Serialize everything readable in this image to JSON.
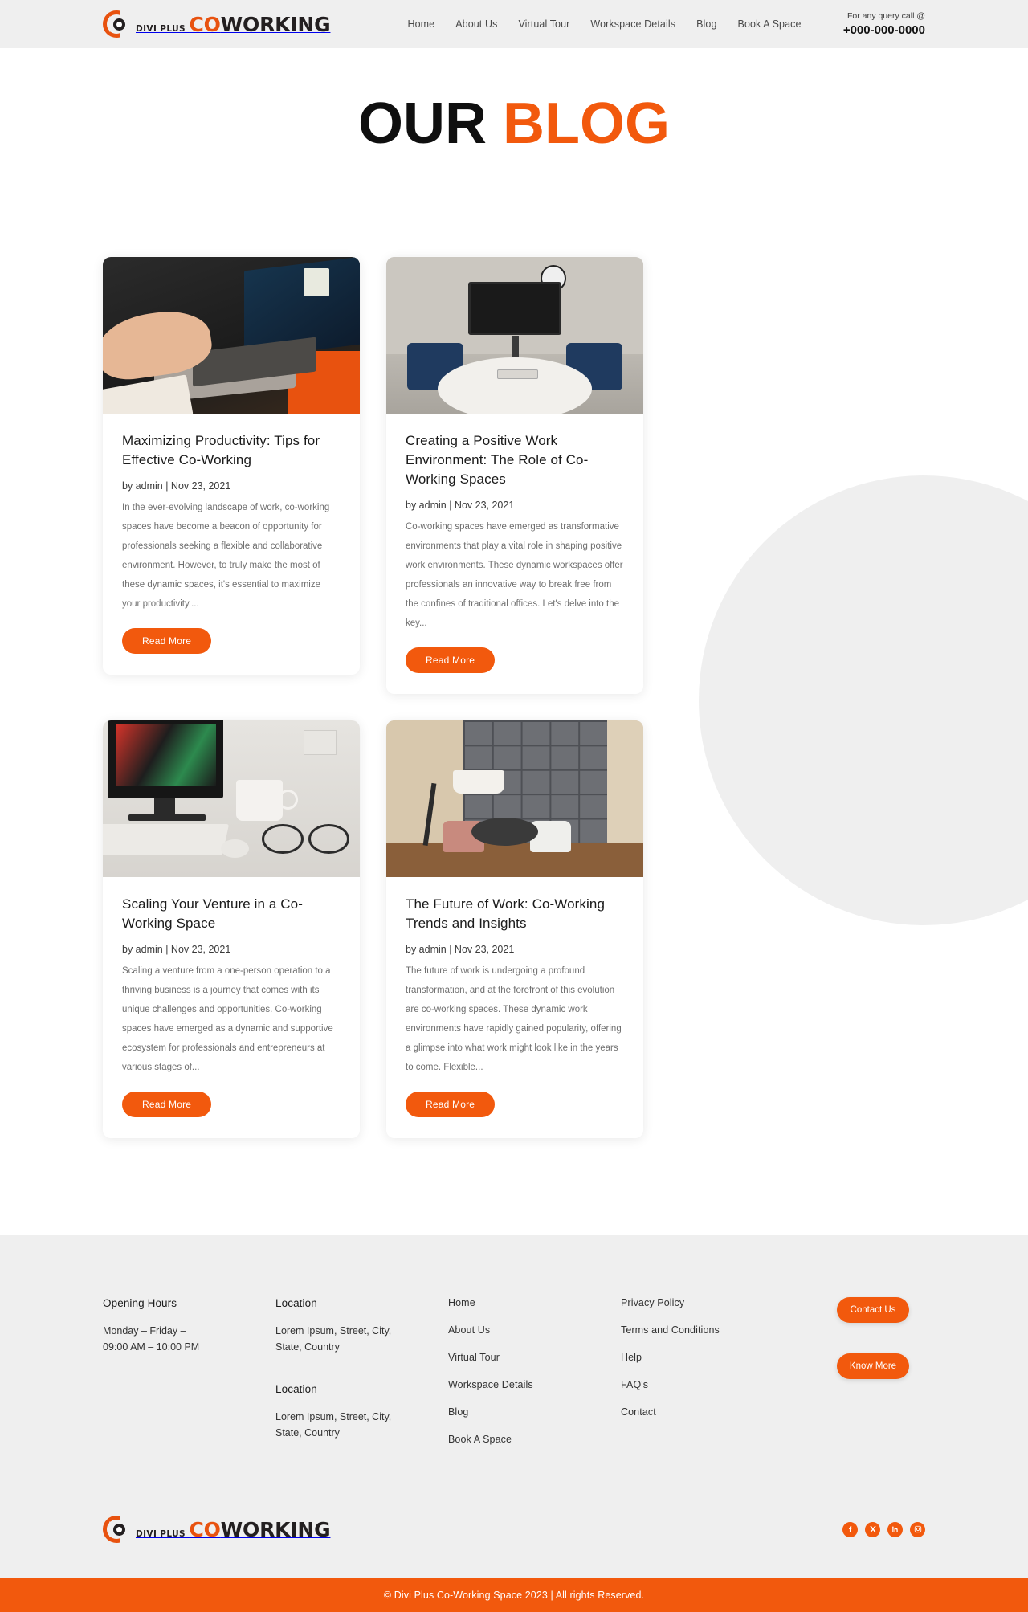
{
  "header": {
    "logo": {
      "kicker": "DIVI PLUS",
      "word_accent": "CO",
      "word_rest": "WORKING"
    },
    "nav": [
      {
        "label": "Home"
      },
      {
        "label": "About Us"
      },
      {
        "label": "Virtual Tour"
      },
      {
        "label": "Workspace Details"
      },
      {
        "label": "Blog"
      },
      {
        "label": "Book A Space"
      }
    ],
    "contact": {
      "query_label": "For any query call @",
      "phone": "+000-000-0000"
    }
  },
  "hero": {
    "title_dark": "OUR",
    "title_accent": "BLOG"
  },
  "blog": {
    "posts": [
      {
        "title": "Maximizing Productivity: Tips for Effective Co-Working",
        "meta": "by admin | Nov 23, 2021",
        "excerpt": "In the ever-evolving landscape of work, co-working spaces have become a beacon of opportunity for professionals seeking a flexible and collaborative environment. However, to truly make the most of these dynamic spaces, it's essential to maximize your productivity....",
        "button": "Read More",
        "image": "person-typing-on-laptop-photo"
      },
      {
        "title": "Creating a Positive Work Environment: The Role of Co-Working Spaces",
        "meta": "by admin | Nov 23, 2021",
        "excerpt": "Co-working spaces have emerged as transformative environments that play a vital role in shaping positive work environments. These dynamic workspaces offer professionals an innovative way to break free from the confines of traditional offices. Let's delve into the key...",
        "button": "Read More",
        "image": "meeting-room-with-monitor-photo"
      },
      {
        "title": "Scaling Your Venture in a Co-Working Space",
        "meta": "by admin | Nov 23, 2021",
        "excerpt": "Scaling a venture from a one-person operation to a thriving business is a journey that comes with its unique challenges and opportunities. Co-working spaces have emerged as a dynamic and supportive ecosystem for professionals and entrepreneurs at various stages of...",
        "button": "Read More",
        "image": "desk-with-monitor-mug-glasses-photo"
      },
      {
        "title": "The Future of Work: Co-Working Trends and Insights",
        "meta": "by admin | Nov 23, 2021",
        "excerpt": "The future of work is undergoing a profound transformation, and at the forefront of this evolution are co-working spaces. These dynamic work environments have rapidly gained popularity, offering a glimpse into what work might look like in the years to come. Flexible...",
        "button": "Read More",
        "image": "lounge-with-bookshelf-photo"
      }
    ]
  },
  "footer": {
    "hours": {
      "heading": "Opening Hours",
      "line1": "Monday – Friday –",
      "line2": "09:00 AM – 10:00 PM"
    },
    "locations": [
      {
        "heading": "Location",
        "line1": "Lorem Ipsum, Street, City,",
        "line2": "State, Country"
      },
      {
        "heading": "Location",
        "line1": "Lorem Ipsum, Street, City,",
        "line2": "State, Country"
      }
    ],
    "nav_links": [
      {
        "label": "Home"
      },
      {
        "label": "About Us"
      },
      {
        "label": "Virtual Tour"
      },
      {
        "label": "Workspace Details"
      },
      {
        "label": "Blog"
      },
      {
        "label": "Book A Space"
      }
    ],
    "info_links": [
      {
        "label": "Privacy Policy"
      },
      {
        "label": "Terms and Conditions"
      },
      {
        "label": "Help"
      },
      {
        "label": "FAQ's"
      },
      {
        "label": "Contact"
      }
    ],
    "buttons": [
      {
        "label": "Contact Us"
      },
      {
        "label": "Know More"
      }
    ],
    "socials": [
      {
        "name": "facebook-icon"
      },
      {
        "name": "x-twitter-icon"
      },
      {
        "name": "linkedin-icon"
      },
      {
        "name": "instagram-icon"
      }
    ],
    "copyright": "© Divi Plus Co-Working Space 2023 | All rights Reserved."
  },
  "colors": {
    "accent": "#F2590D",
    "logo_accent": "#E8520F",
    "light_bg": "#efefef",
    "text_dark": "#1b1b1b",
    "text_muted": "#6f6f6f"
  }
}
